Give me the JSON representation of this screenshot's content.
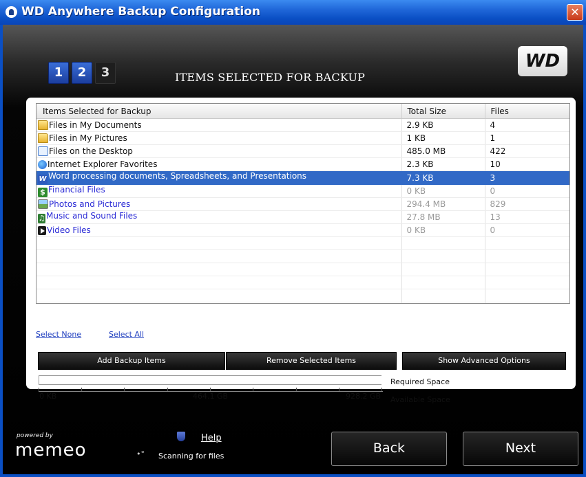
{
  "window": {
    "title": "WD Anywhere Backup Configuration",
    "close_glyph": "✕"
  },
  "steps": [
    "1",
    "2",
    "3"
  ],
  "page_heading": "ITEMS SELECTED FOR BACKUP",
  "brand": {
    "logo_text": "WD"
  },
  "table": {
    "columns": [
      "Items Selected for Backup",
      "Total Size",
      "Files"
    ],
    "rows": [
      {
        "icon": "documents-folder-icon",
        "name": "Files in My Documents",
        "size": "2.9 KB",
        "files": "4",
        "state": "normal"
      },
      {
        "icon": "pictures-folder-icon",
        "name": "Files in My Pictures",
        "size": "1 KB",
        "files": "1",
        "state": "normal"
      },
      {
        "icon": "desktop-icon",
        "name": "Files on the Desktop",
        "size": "485.0 MB",
        "files": "422",
        "state": "normal"
      },
      {
        "icon": "internet-explorer-icon",
        "name": "Internet Explorer Favorites",
        "size": "2.3 KB",
        "files": "10",
        "state": "normal"
      },
      {
        "icon": "word-document-icon",
        "name": "Word processing documents, Spreadsheets, and Presentations",
        "size": "7.3 KB",
        "files": "3",
        "state": "selected"
      },
      {
        "icon": "dollar-icon",
        "name": "Financial Files",
        "size": "0 KB",
        "files": "0",
        "state": "unchecked"
      },
      {
        "icon": "photo-icon",
        "name": "Photos and Pictures",
        "size": "294.4 MB",
        "files": "829",
        "state": "unchecked"
      },
      {
        "icon": "music-note-icon",
        "name": "Music and Sound Files",
        "size": "27.8 MB",
        "files": "13",
        "state": "unchecked"
      },
      {
        "icon": "video-icon",
        "name": "Video Files",
        "size": "0 KB",
        "files": "0",
        "state": "unchecked"
      }
    ],
    "empty_rows": 7
  },
  "links": {
    "select_none": "Select None",
    "select_all": "Select All"
  },
  "buttons": {
    "add_backup_items": "Add Backup Items",
    "remove_selected_items": "Remove Selected Items",
    "show_advanced_options": "Show Advanced Options",
    "back": "Back",
    "next": "Next"
  },
  "space": {
    "required_label": "Required Space",
    "available_label": "Available Space",
    "scale_min": "0 KB",
    "scale_mid": "464.1 GB",
    "scale_max": "928.2 GB"
  },
  "footer": {
    "powered_by": "powered by",
    "brand": "memeo",
    "help": "Help",
    "status": "Scanning for files"
  },
  "colors": {
    "titlebar": "#0a4fc4",
    "step_active": "#2b56c0",
    "selection": "#3169c6",
    "unchecked_text": "#2b2bd6"
  }
}
